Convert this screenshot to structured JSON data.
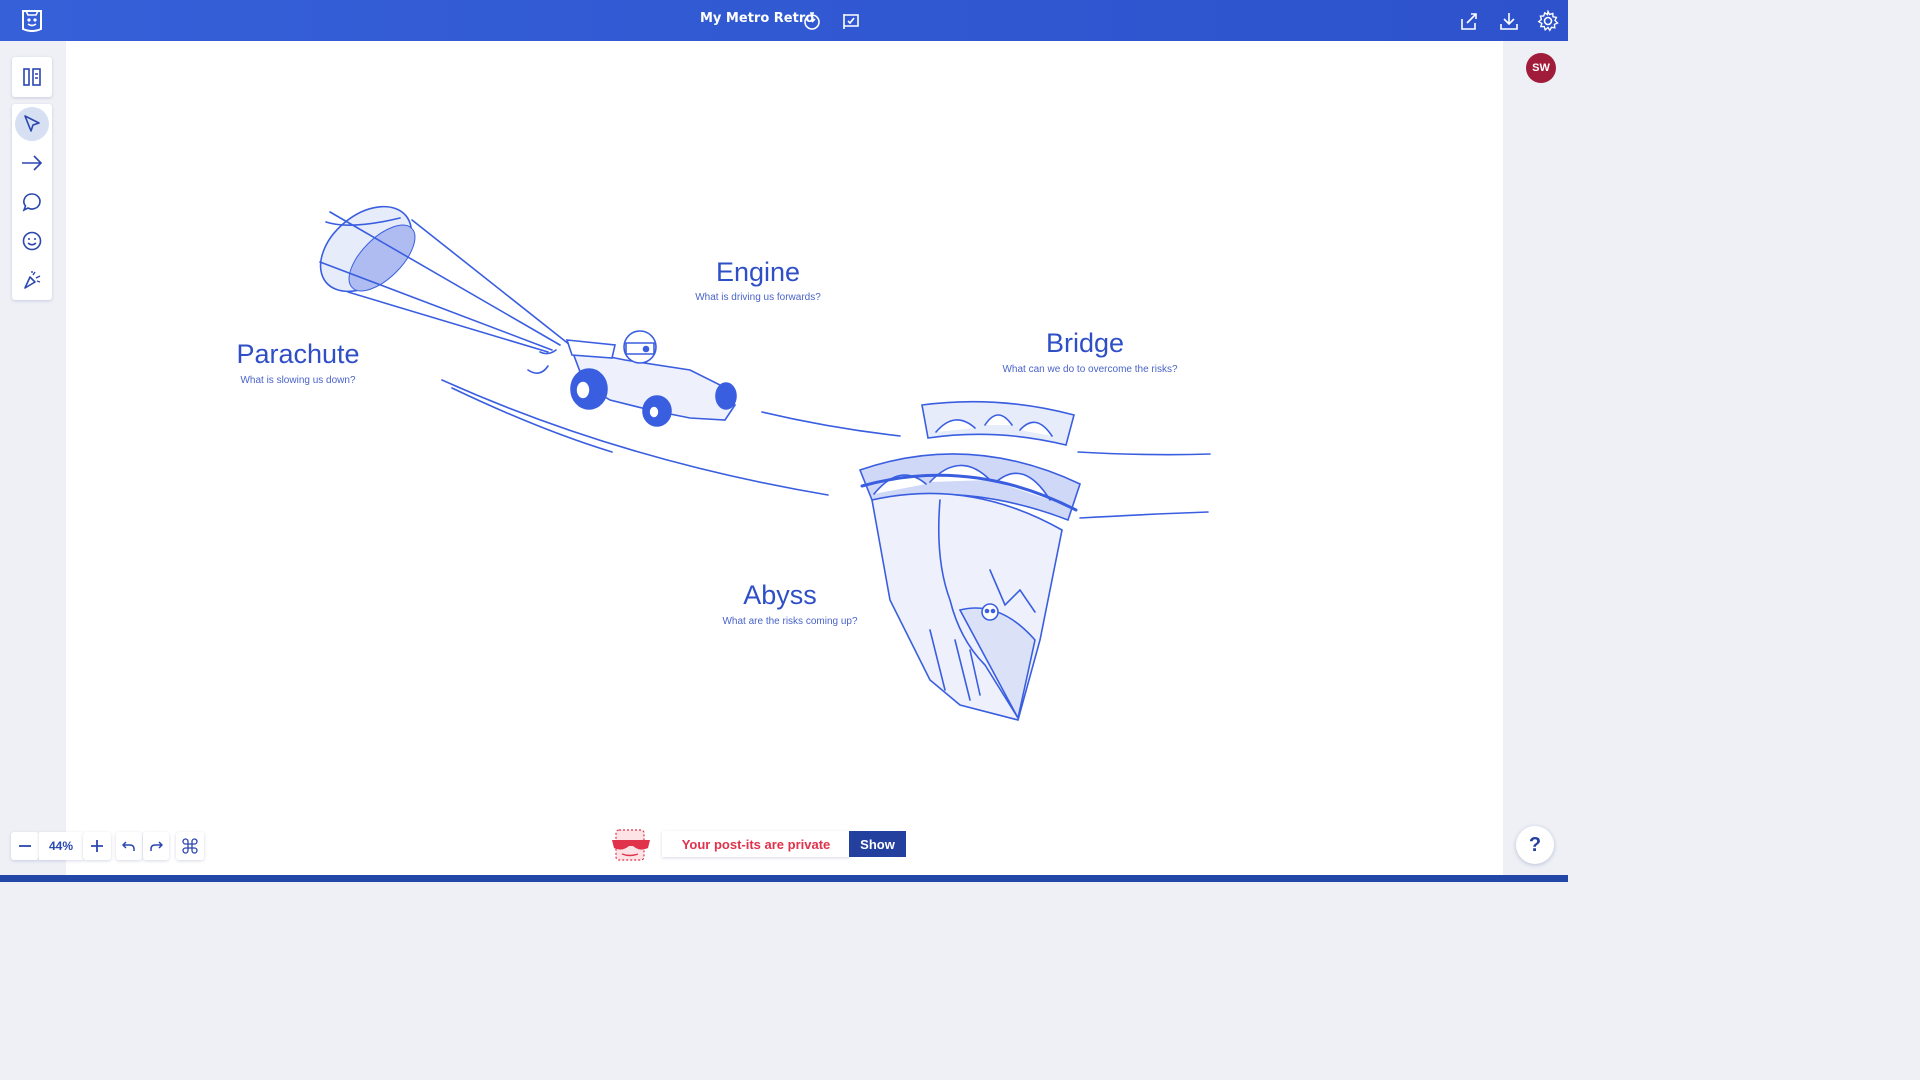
{
  "header": {
    "title": "My Metro Retro",
    "icons": [
      "app-logo-icon",
      "timer-icon",
      "checklist-flag-icon",
      "share-icon",
      "download-icon",
      "settings-gear-icon"
    ]
  },
  "user": {
    "initials": "SW",
    "avatar_color": "#a11c3a"
  },
  "toolbar": {
    "tools": [
      "panels-icon",
      "select-pointer-icon",
      "arrow-connector-icon",
      "comment-bubble-icon",
      "emoji-smile-icon",
      "celebrate-confetti-icon"
    ],
    "active_tool": "select-pointer-icon"
  },
  "board": {
    "template": "Speed Car",
    "sections": [
      {
        "title": "Engine",
        "subtitle": "What is driving us forwards?"
      },
      {
        "title": "Parachute",
        "subtitle": "What is slowing us down?"
      },
      {
        "title": "Bridge",
        "subtitle": "What can we do to overcome the risks?"
      },
      {
        "title": "Abyss",
        "subtitle": "What are the risks coming up?"
      }
    ]
  },
  "zoom": {
    "value": "44%"
  },
  "privacy": {
    "message": "Your post-its are private",
    "show_label": "Show"
  },
  "help": {
    "label": "?"
  },
  "colors": {
    "accent": "#2f55d4",
    "illustration": "#3a5ee0",
    "privacy_red": "#e0324b",
    "show_button": "#23409f"
  }
}
